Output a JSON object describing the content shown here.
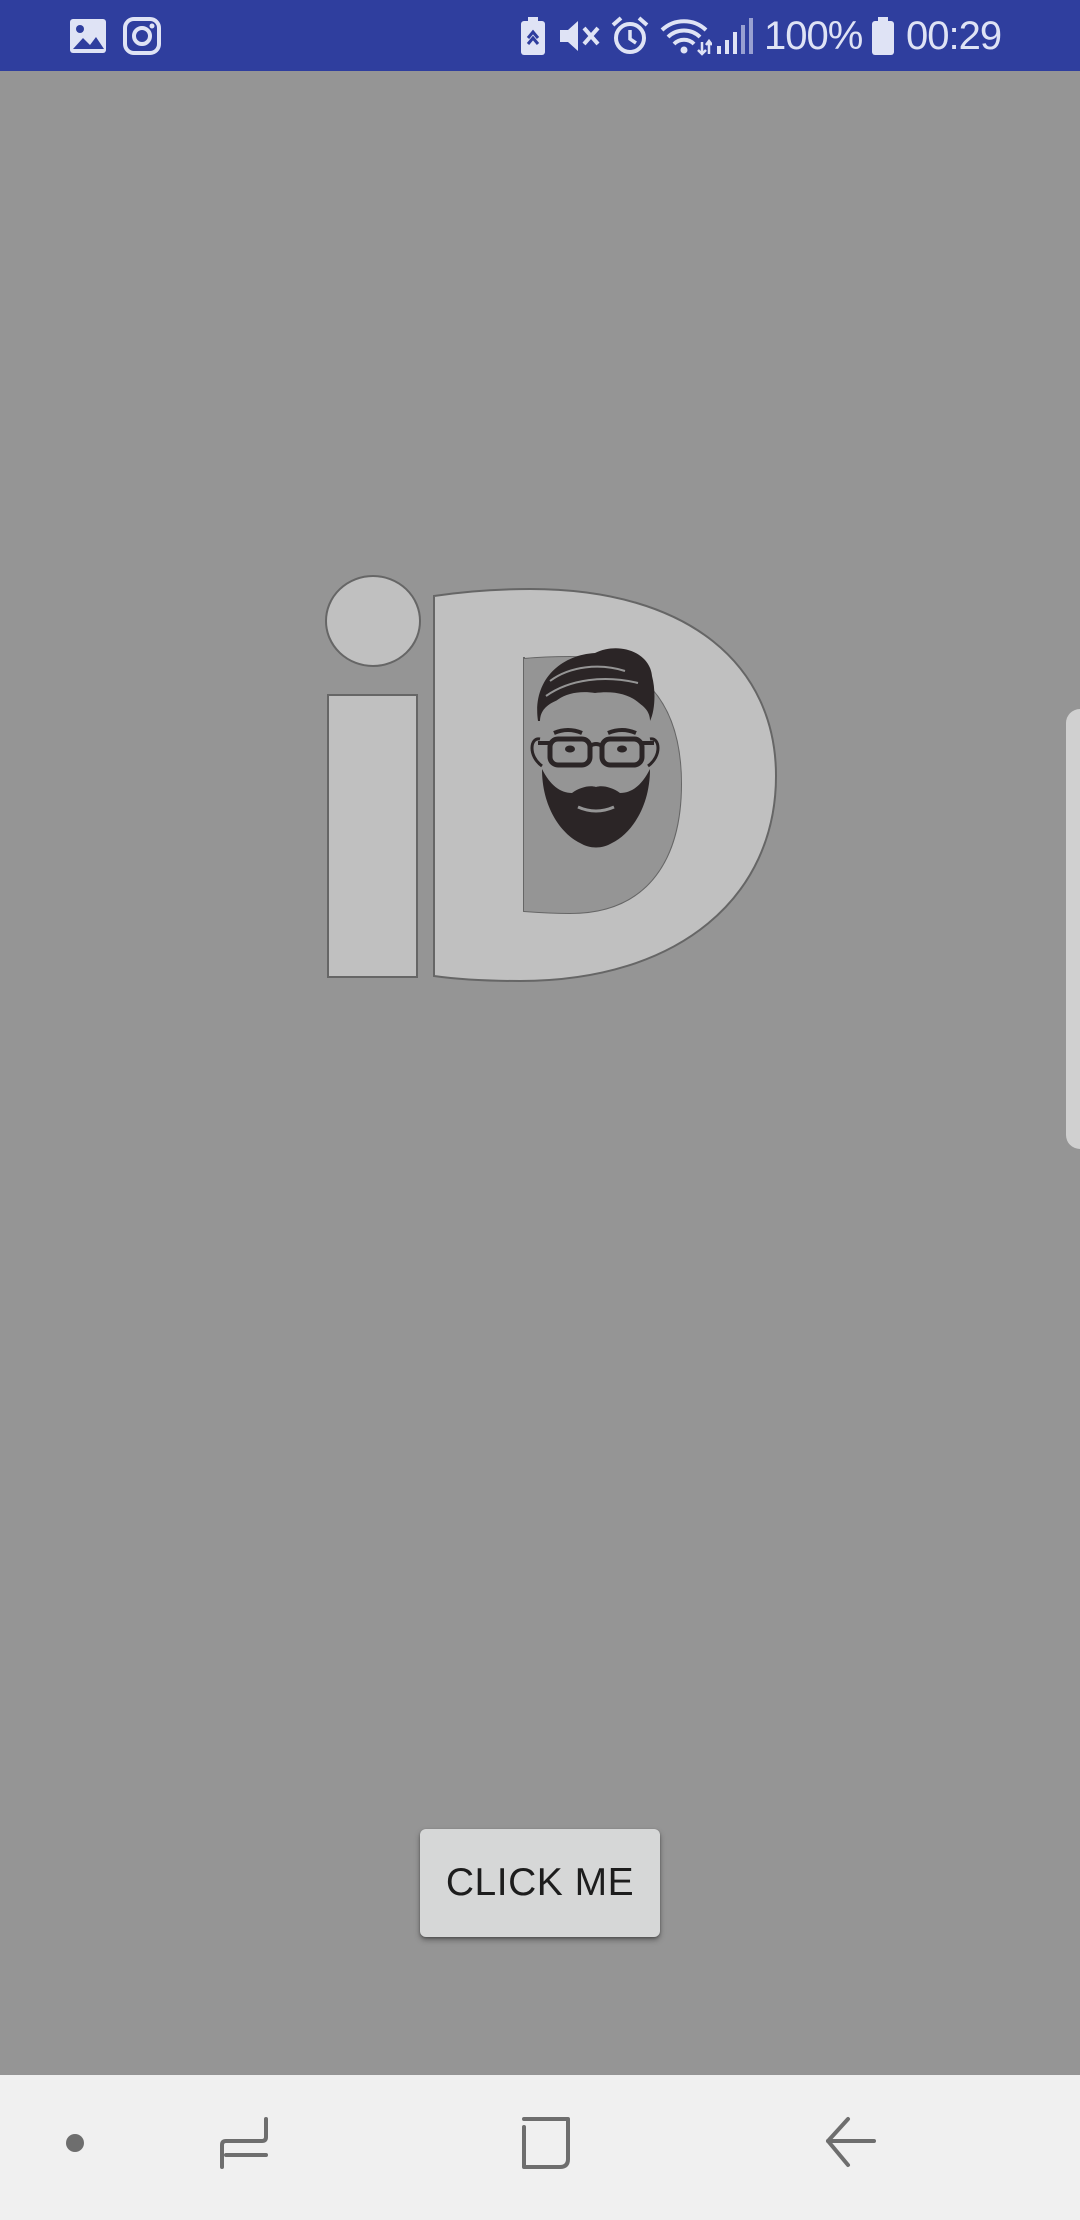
{
  "status_bar": {
    "battery_percent": "100%",
    "time": "00:29",
    "background_color": "#2f3e9e",
    "left_icons": [
      "gallery-icon",
      "instagram-icon"
    ],
    "right_icons": [
      "battery-saver-icon",
      "vibrate-mute-icon",
      "alarm-icon",
      "wifi-icon",
      "signal-icon",
      "battery-icon"
    ]
  },
  "main": {
    "background_color": "#959595",
    "logo_icon": "id-beard-glasses-logo",
    "button": {
      "label": "CLICK ME"
    }
  },
  "nav_bar": {
    "items": [
      "home-dot-icon",
      "recent-apps-icon",
      "overview-icon",
      "back-icon"
    ],
    "background_color": "#f0f0f0"
  }
}
